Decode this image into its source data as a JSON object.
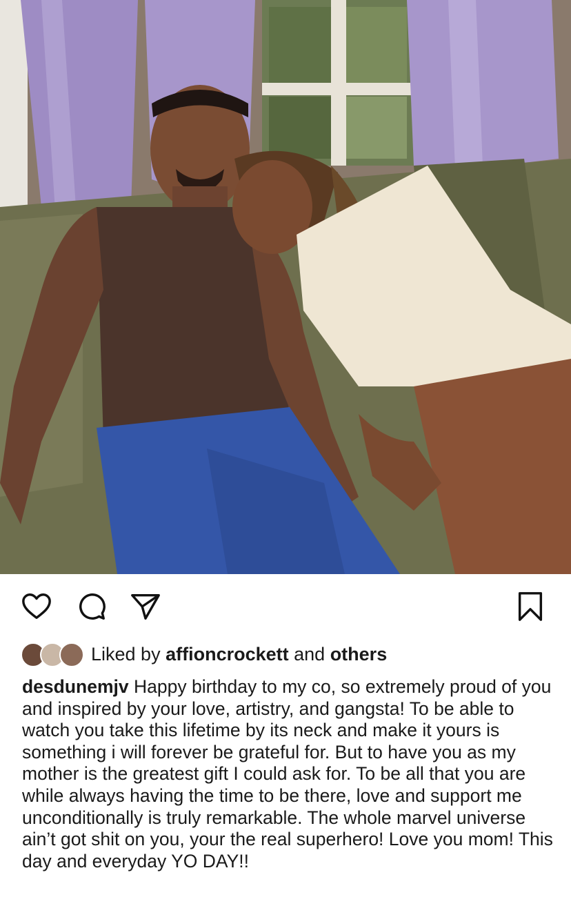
{
  "post": {
    "photo_description_icon": "photo",
    "actions": {
      "like_icon": "heart-icon",
      "comment_icon": "comment-icon",
      "share_icon": "send-icon",
      "save_icon": "bookmark-icon"
    },
    "likes": {
      "prefix": "Liked by ",
      "first_liker": "affioncrockett",
      "middle": " and ",
      "others": "others"
    },
    "caption": {
      "username": "desdunemjv",
      "text": " Happy birthday to my co, so extremely proud of you and inspired by your love, artistry, and gangsta! To be able to watch you take this lifetime by its neck and make it yours is something i will forever be grateful for. But to have you as my mother is the greatest gift I could ask for. To be all that you are while always having the time to be there, love and support me unconditionally is truly remarkable. The whole marvel universe ain’t got shit on you, your the real superhero! Love you mom! This day and everyday YO DAY!!"
    }
  },
  "colors": {
    "text": "#1a1a1a",
    "icon": "#111111",
    "background": "#ffffff"
  }
}
